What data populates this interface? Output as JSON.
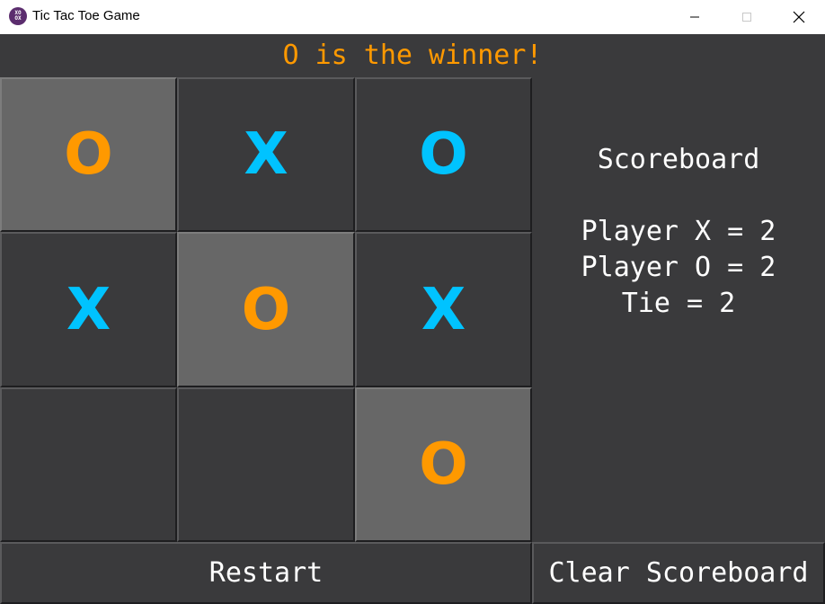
{
  "window": {
    "title": "Tic Tac Toe Game",
    "icon": "xo-app-icon"
  },
  "status": {
    "text": "O is the winner!",
    "color": "#ff9900"
  },
  "board": {
    "cells": [
      {
        "mark": "O",
        "winning": true
      },
      {
        "mark": "X",
        "winning": false
      },
      {
        "mark": "O",
        "winning": false
      },
      {
        "mark": "X",
        "winning": false
      },
      {
        "mark": "O",
        "winning": true
      },
      {
        "mark": "X",
        "winning": false
      },
      {
        "mark": "",
        "winning": false
      },
      {
        "mark": "",
        "winning": false
      },
      {
        "mark": "O",
        "winning": true
      }
    ],
    "colors": {
      "normal_mark": "#00c3ff",
      "winning_mark": "#ff9900",
      "winning_bg": "#676767",
      "cell_bg": "#3a3a3c"
    }
  },
  "scoreboard": {
    "title": "Scoreboard",
    "player_x": "Player X = 2",
    "player_o": "Player O = 2",
    "tie": "Tie = 2"
  },
  "buttons": {
    "restart": "Restart",
    "clear": "Clear Scoreboard"
  }
}
